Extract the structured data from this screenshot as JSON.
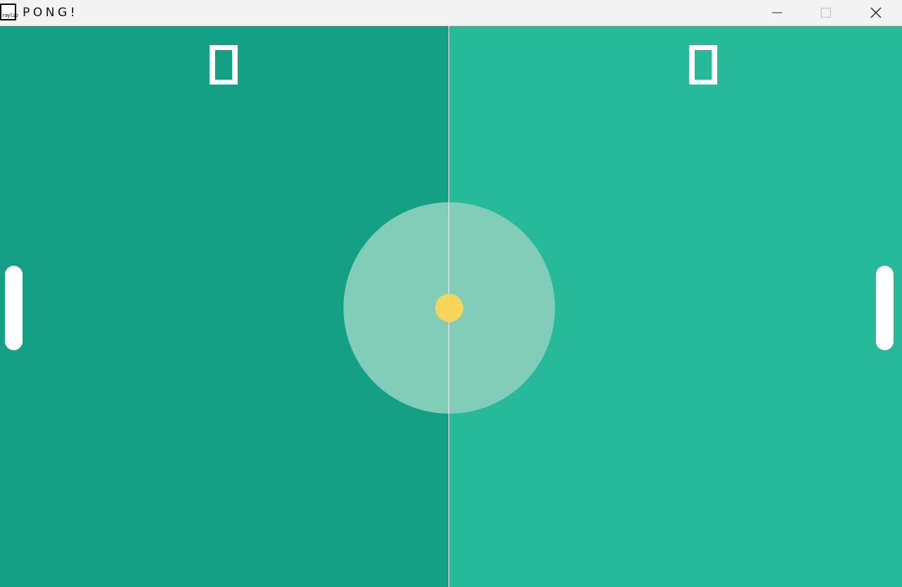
{
  "window": {
    "title": "PONG!",
    "icon_label": "raylib",
    "controls": {
      "minimize_icon": "minimize-icon",
      "maximize_icon": "maximize-icon",
      "close_icon": "close-icon"
    }
  },
  "game": {
    "scores": {
      "left": "0",
      "right": "0"
    },
    "colors": {
      "left_half": "#14a085",
      "right_half": "#26b99a",
      "center_circle": "#81cdb8",
      "ball": "#f5d65a",
      "paddle": "#ffffff",
      "center_line": "#ffffff",
      "score": "#ffffff"
    }
  }
}
